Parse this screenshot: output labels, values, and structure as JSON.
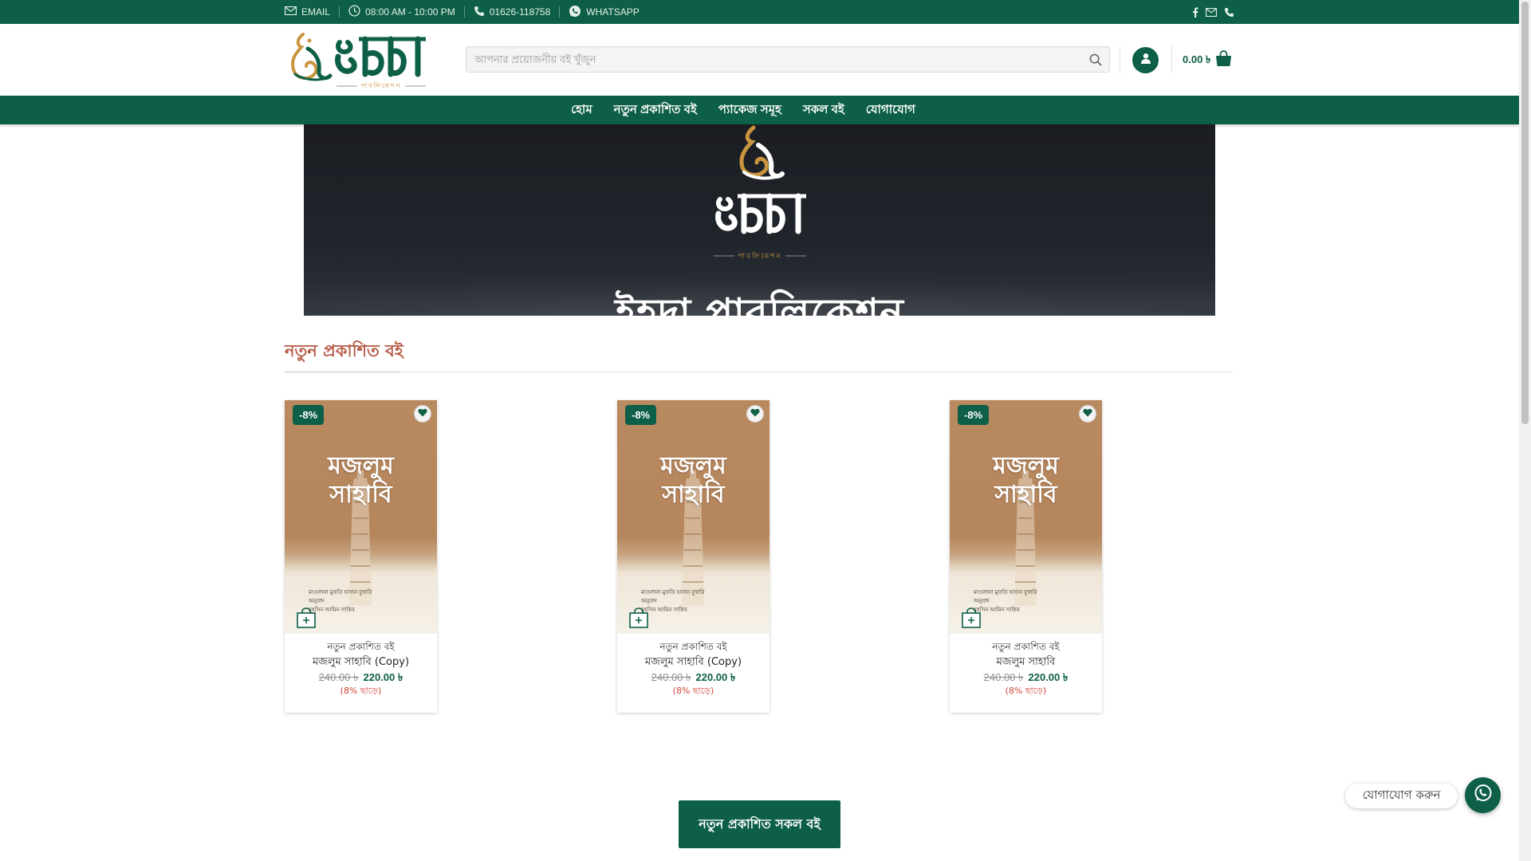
{
  "topbar": {
    "email_label": "EMAIL",
    "hours_label": "08:00 AM - 10:00 PM",
    "phone_label": "01626-118758",
    "whatsapp_label": "WHATSAPP"
  },
  "header": {
    "logo_text": "ইহদা",
    "logo_sub": "পাবলিকেশন",
    "search_placeholder": "আপনার প্রয়োজনীয় বই খুঁজুন",
    "cart_total": "0.00 ৳"
  },
  "nav": {
    "items": [
      {
        "label": "হোম"
      },
      {
        "label": "নতুন প্রকাশিত বই"
      },
      {
        "label": "প্যাকেজ সমূহ"
      },
      {
        "label": "সকল বই"
      },
      {
        "label": "যোগাযোগ"
      }
    ]
  },
  "hero": {
    "logo_text": "ইহদা",
    "logo_sub": "পাবলিকেশন",
    "title": "ইহদা পাবলিকেশন"
  },
  "section": {
    "title": "নতুন প্রকাশিত বই"
  },
  "products": [
    {
      "badge": "-8%",
      "cover_title_1": "মজলুম",
      "cover_title_2": "সাহাবি",
      "cover_author": "মাওলানা মুফতি হাসান বুখারি",
      "cover_translator_label": "অনুবাদ",
      "cover_translator": "মুহসিন আমিন সাকিব",
      "category": "নতুন প্রকাশিত বই",
      "name": "মজলুম সাহাবি (Copy)",
      "old_price": "240.00 ৳",
      "price": "220.00 ৳",
      "discount": "(8% ছাড়ে)"
    },
    {
      "badge": "-8%",
      "cover_title_1": "মজলুম",
      "cover_title_2": "সাহাবি",
      "cover_author": "মাওলানা মুফতি হাসান বুখারি",
      "cover_translator_label": "অনুবাদ",
      "cover_translator": "মুহসিন আমিন সাকিব",
      "category": "নতুন প্রকাশিত বই",
      "name": "মজলুম সাহাবি (Copy)",
      "old_price": "240.00 ৳",
      "price": "220.00 ৳",
      "discount": "(8% ছাড়ে)"
    },
    {
      "badge": "-8%",
      "cover_title_1": "মজলুম",
      "cover_title_2": "সাহাবি",
      "cover_author": "মাওলানা মুফতি হাসান বুখারি",
      "cover_translator_label": "অনুবাদ",
      "cover_translator": "মুহসিন আমিন সাকিব",
      "category": "নতুন প্রকাশিত বই",
      "name": "মজলুম সাহাবি",
      "old_price": "240.00 ৳",
      "price": "220.00 ৳",
      "discount": "(8% ছাড়ে)"
    }
  ],
  "cta": {
    "label": "নতুন প্রকাশিত সকল বই"
  },
  "whatsapp_float": {
    "label": "যোগাযোগ করুন"
  },
  "colors": {
    "brand_green": "#0d5f47",
    "accent_rust": "#b85b46",
    "gold": "#c9953f",
    "sale_red": "#d2453b"
  },
  "icons": {
    "topbar": [
      "envelope-icon",
      "clock-icon",
      "phone-icon",
      "whatsapp-icon"
    ],
    "social": [
      "facebook-icon",
      "envelope-icon",
      "phone-icon"
    ],
    "header": [
      "search-icon",
      "user-icon",
      "shopping-bag-icon"
    ],
    "product": [
      "heart-icon",
      "add-to-cart-bag-icon"
    ]
  }
}
